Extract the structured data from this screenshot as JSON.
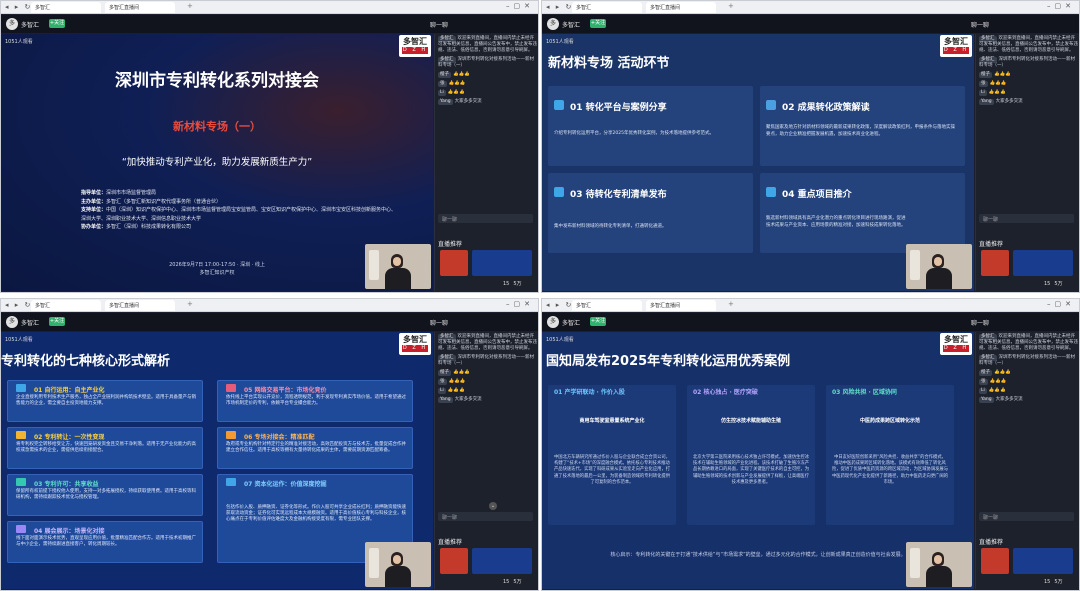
{
  "browser": {
    "tab1": "多智汇",
    "tab2": "多智汇直播间"
  },
  "header": {
    "host": "多智汇",
    "follow": "+关注",
    "talk_label": "聊一聊"
  },
  "viewers": "1051人观看",
  "brand": {
    "line1": "多智汇",
    "line2": "D Z H"
  },
  "chat": {
    "msgs": [
      {
        "user": "多智汇",
        "text": "欢迎来到直播间，直播间内禁止未经许可发布相关信息，直播间公告发布中，禁止发布违规、违法、低俗信息，否则请勿恶意引导刷屏。"
      },
      {
        "user": "多智汇",
        "text": "深圳市专利转化对接系列活动——新材料专场（一）"
      },
      {
        "user": "橙子",
        "text": "👍👍👍"
      },
      {
        "user": "张",
        "text": "👍👍👍"
      },
      {
        "user": "Li",
        "text": "👍👍👍"
      },
      {
        "user": "Yang",
        "text": "大家多多交流"
      }
    ],
    "input_placeholder": "聊一聊",
    "recommend": "直播推荐",
    "like1": "15",
    "like2": "5万"
  },
  "slide1": {
    "title": "深圳市专利转化系列对接会",
    "subtitle": "新材料专场（一）",
    "slogan": "“加快推动专利产业化，助力发展新质生产力”",
    "orgs": [
      {
        "k": "指导单位：",
        "v": "深圳市市场监督管理局"
      },
      {
        "k": "主办单位：",
        "v": "多智汇（多智汇新知识产权代理事务所（普通合伙）"
      },
      {
        "k": "支持单位：",
        "v": "中国（深圳）知识产权保护中心、深圳市市场监督管理局宝安监管局、宝安区知识产权保护中心、深圳市宝安区科技创新服务中心、深圳大学、深圳职业技术大学、深圳信息职业技术大学"
      },
      {
        "k": "协办单位：",
        "v": "多智汇（深圳）科技成果转化有限公司"
      }
    ],
    "date": "2026年9月7日 17:00-17:50 · 深圳 · 线上",
    "org_footer": "多智汇知识产权"
  },
  "slide2": {
    "title": "新材料专场 活动环节",
    "cards": [
      {
        "num": "01 转化平台与案例分享",
        "desc": "介绍专利转化运用平台，分享2025年优秀转化案例，为技术落地提供参考范式。"
      },
      {
        "num": "02 成果转化政策解读",
        "desc": "聚焦国家及地方针对新材料领域的最新成果转化政策，深度解读政策红利，申报条件与落地实操要点，助力企业精准把握发展机遇，加速技术商业化进程。"
      },
      {
        "num": "03 待转化专利清单发布",
        "desc": "集中发布新材料领域的待转化专利清单，打通转化通道。"
      },
      {
        "num": "04 重点项目推介",
        "desc": "甄选新材料领域具有高产业化潜力的重点转化项目进行现场路演，促进技术成果与产业资本、应用场景的精准对接，加速科技成果转化落地。"
      }
    ]
  },
  "slide3": {
    "title": "专利转化的七种核心形式解析",
    "items": [
      {
        "t": "01 自行运用：自主产业化",
        "d": "企业直接利用专利技术生产服务，独占全产业链利润并构筑技术壁垒。适用于具备量产与销售能力的企业，需全要自主投资地能力支撑。"
      },
      {
        "t": "02 专利转让：一次性变现",
        "d": "将专利权完全转移给受让方，快速回笼研发资金且交易干净利落。适用于无产业化能力的高校或急需技术的企业，需提供后续衔接配合。"
      },
      {
        "t": "03 专利许可：共享收益",
        "d": "保留所有权前提下授权他人使用，支持一对多拓展授权，持续获取使用费。适用于高校等科研机构，需持续跟踪技术优化与授权管理。"
      },
      {
        "t": "04 展会展示：场景化对接",
        "d": "线下面对面演示技术优势，直观呈现应用价值，批量精准匹配合作方。适用于技术初期推广与中小企业，需持续跟进直接客户，转化周期较长。"
      },
      {
        "t": "05 网络交易平台：市场化竞价",
        "d": "依托线上平台实现公开竞价，流程透明规范，利于发现专利真实市场价值。适用于希望通过市场机制定价的专利，依赖平台专业撮合能力。"
      },
      {
        "t": "06 专场对接会：精准匹配",
        "d": "政府或专业机构针对特定行业的精准对接活动，高效匹配投资方与技术方，批量促成合作并建立合作信任。适用于高校等拥有大量待转化成果的主体，需要前期资源匹配筹备。"
      },
      {
        "t": "07 资本化运作：价值深度挖掘",
        "d": "包括作价入股、质押融资、证券化等形式。作价入股可共享企业成长红利；质押融资能快速获取流动资金；证券化可实现远程成本大规模融资。适用于高价值核心专利与科技企业，核心痛点在于专利价值评估难度大及金融机构接受度有限，需专业团队支撑。"
      }
    ]
  },
  "slide4": {
    "title": "国知局发布2025年专利转化运用优秀案例",
    "cards": [
      {
        "t": "01 产学研联动 · 作价入股",
        "s": "商用车驾驶室悬置系统产业化",
        "d": "中国北方车辆研究所通过作价入股与企业联合成立合资公司，构建了“技术+市场”的深度融合模式。依托核心专利技术推动产品快速迭代，实现了科研成果从实验室走向产业化应用，打通了技术落地的最后一公里，为装备制造领域的专利转化提供了可复制的合作范本。"
      },
      {
        "t": "02 核心独占 · 医疗突破",
        "s": "仿生控冰技术赋能辅助生殖",
        "d": "北京大学第三医院采用核心技术独占许可模式，加速仿生控冰技术在辅助生殖领域的产业化进程。该技术打破了生殖冷冻产品长期依赖进口的局面，实现了关键医疗技术的自主可控，为辅助生殖领域的技术创新与产业发展提供了样板，让高端医疗技术惠及更多患者。"
      },
      {
        "t": "03 风险共担 · 区域协同",
        "s": "中医药成果跨区域转化示范",
        "d": "中日友好医院创新采用“风险共担、收益共享”的合作模式，推动中医药成果跨区域转化落地。该模式有效降低了转化风险，促进了优质中医药资源的跨区域流动，为区域协调发展与中医药现代化产业化提供了新路径，助力中医药走向更广阔的市场。"
      }
    ],
    "hint": "核心启示：专利转化的关键在于打通“技术供给”与“市场需求”的壁垒，通过多元化的合作模式，让创新成果真正创造价值与社会发展。"
  },
  "colors": {
    "accent_red": "#e94c3f",
    "accent_green": "#2fb26b",
    "teal": "#36c7b0"
  }
}
